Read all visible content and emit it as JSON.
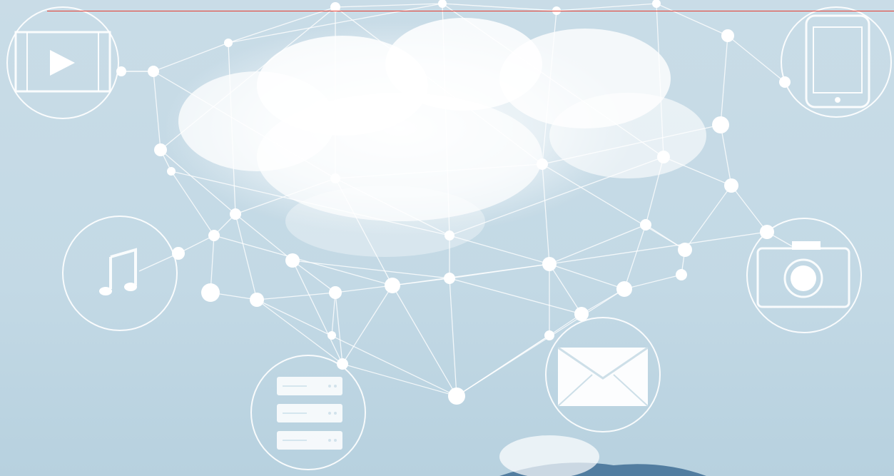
{
  "scene": {
    "description_icons": [
      "video-icon",
      "tablet-icon",
      "music-note-icon",
      "camera-icon",
      "email-icon",
      "server-icon"
    ],
    "colors": {
      "sky_top": "#c8dbe6",
      "sky_bottom": "#b9d3e1",
      "network": "#ffffff",
      "accent_line": "#e53b2f",
      "sea": "#3f6f95"
    }
  }
}
